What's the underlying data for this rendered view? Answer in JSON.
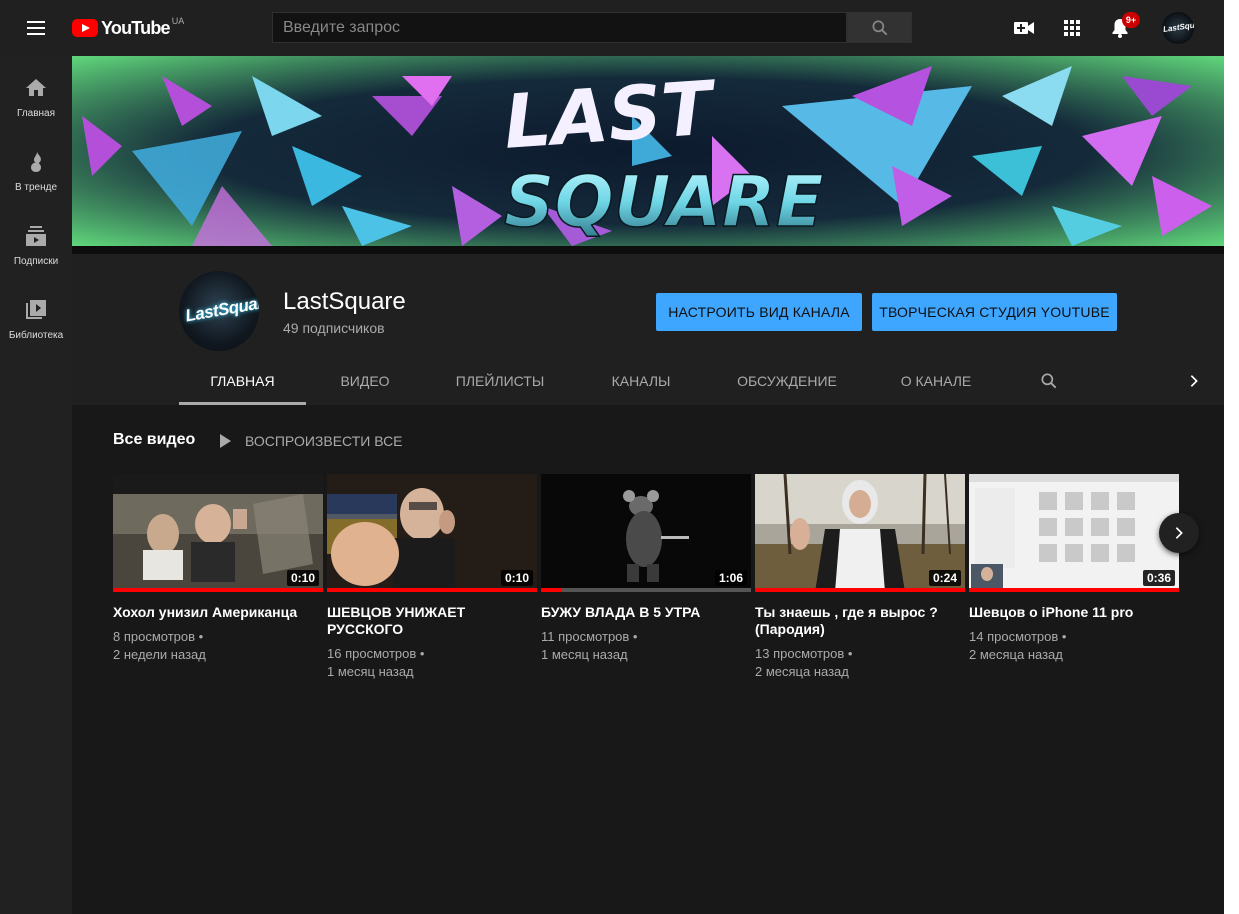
{
  "topbar": {
    "logo_text": "YouTube",
    "logo_region": "UA",
    "search_placeholder": "Введите запрос",
    "notifications_count": "9+",
    "avatar_text": "LastSquare"
  },
  "sidebar": {
    "items": [
      {
        "label": "Главная",
        "icon": "home-icon"
      },
      {
        "label": "В тренде",
        "icon": "flame-icon"
      },
      {
        "label": "Подписки",
        "icon": "subscriptions-icon"
      },
      {
        "label": "Библиотека",
        "icon": "library-icon"
      }
    ]
  },
  "banner": {
    "line1": "LAST",
    "line2": "SQUARE"
  },
  "channel": {
    "avatar_text": "LastSquare",
    "name": "LastSquare",
    "subscribers": "49 подписчиков",
    "customize_button": "НАСТРОИТЬ ВИД КАНАЛА",
    "studio_button": "ТВОРЧЕСКАЯ СТУДИЯ YOUTUBE",
    "tabs": [
      {
        "label": "ГЛАВНАЯ",
        "active": true
      },
      {
        "label": "ВИДЕО",
        "active": false
      },
      {
        "label": "ПЛЕЙЛИСТЫ",
        "active": false
      },
      {
        "label": "КАНАЛЫ",
        "active": false
      },
      {
        "label": "ОБСУЖДЕНИЕ",
        "active": false
      },
      {
        "label": "О КАНАЛЕ",
        "active": false
      }
    ]
  },
  "content": {
    "section_title": "Все видео",
    "play_all": "ВОСПРОИЗВЕСТИ ВСЕ",
    "videos": [
      {
        "title": "Хохол унизил Американца",
        "views": "8 просмотров",
        "age": "2 недели назад",
        "duration": "0:10",
        "watched": 1.0
      },
      {
        "title": "ШЕВЦОВ УНИЖАЕТ РУССКОГО",
        "views": "16 просмотров",
        "age": "1 месяц назад",
        "duration": "0:10",
        "watched": 1.0
      },
      {
        "title": "БУЖУ ВЛАДА В 5 УТРА",
        "views": "11 просмотров",
        "age": "1 месяц назад",
        "duration": "1:06",
        "watched": 0.1
      },
      {
        "title": "Ты знаешь , где я вырос ? (Пародия)",
        "views": "13 просмотров",
        "age": "2 месяца назад",
        "duration": "0:24",
        "watched": 1.0
      },
      {
        "title": "Шевцов о iPhone 11 pro",
        "views": "14 просмотров",
        "age": "2 месяца назад",
        "duration": "0:36",
        "watched": 1.0
      }
    ]
  },
  "colors": {
    "accent_blue": "#3ea6ff",
    "youtube_red": "#ff0000",
    "background": "#181818"
  }
}
